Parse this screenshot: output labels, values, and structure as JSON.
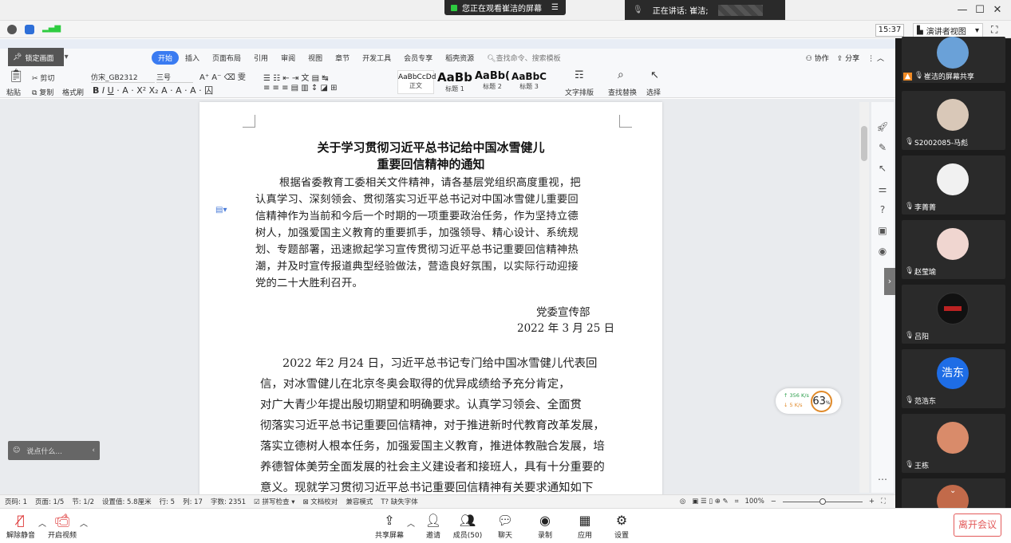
{
  "meeting": {
    "share_banner": "您正在观看崔洁的屏幕",
    "speaker_banner": "正在讲话: 崔洁;",
    "time": "15:37",
    "view_mode": "演讲者视图",
    "lock_label": "锁定画面",
    "chat_placeholder": "说点什么...",
    "leave": "离开会议"
  },
  "wps": {
    "menu": [
      "开始",
      "插入",
      "页面布局",
      "引用",
      "审阅",
      "视图",
      "章节",
      "开发工具",
      "会员专享",
      "稻壳资源"
    ],
    "search": "查找命令、搜索模板",
    "collab": "协作",
    "share": "分享",
    "font": "仿宋_GB2312",
    "font_size": "三号",
    "paste": "粘贴",
    "cut": "剪切",
    "copy": "复制",
    "format_painter": "格式刷",
    "styles": [
      {
        "sample": "AaBbCcDd",
        "name": "正文"
      },
      {
        "sample": "AaBb",
        "name": "标题 1"
      },
      {
        "sample": "AaBb(",
        "name": "标题 2"
      },
      {
        "sample": "AaBbC",
        "name": "标题 3"
      }
    ],
    "text_layout": "文字排版",
    "find_replace": "查找替换",
    "select": "选择"
  },
  "document": {
    "title1": "关于学习贯彻习近平总书记给中国冰雪健儿",
    "title2": "重要回信精神的通知",
    "para1": [
      "根据省委教育工委相关文件精神，请各基层党组织高度重视，把",
      "认真学习、深刻领会、贯彻落实习近平总书记对中国冰雪健儿重要回",
      "信精神作为当前和今后一个时期的一项重要政治任务，作为坚持立德",
      "树人，加强爱国主义教育的重要抓手，加强领导、精心设计、系统规",
      "划、专题部署，迅速掀起学习宣传贯彻习近平总书记重要回信精神热",
      "潮，并及时宣传报道典型经验做法，营造良好氛围，以实际行动迎接",
      "党的二十大胜利召开。"
    ],
    "signer": "党委宣传部",
    "date": "2022 年 3 月 25 日",
    "para2": [
      "2022 年2 月24 日，习近平总书记专门给中国冰雪健儿代表回",
      "信，对冰雪健儿在北京冬奥会取得的优异成绩给予充分肯定，",
      "对广大青少年提出殷切期望和明确要求。认真学习领会、全面贯",
      "彻落实习近平总书记重要回信精神，对于推进新时代教育改革发展，",
      "落实立德树人根本任务，加强爱国主义教育，推进体教融合发展，培",
      "养德智体美劳全面发展的社会主义建设者和接班人，具有十分重要的",
      "意义。现就学习贯彻习近平总书记重要回信精神有关要求通知如下"
    ]
  },
  "status": {
    "items": [
      "页码: 1",
      "页面: 1/5",
      "节: 1/2",
      "设置值: 5.8厘米",
      "行: 5",
      "列: 17",
      "字数: 2351",
      "拼写检查",
      "文档校对",
      "兼容模式",
      "缺失字体"
    ],
    "zoom": "100%"
  },
  "speed": {
    "up": "356 K/s",
    "down": "5 K/s",
    "percent": "63"
  },
  "participants": [
    {
      "name": "崔洁的屏幕共享",
      "color": "#6aa1d8"
    },
    {
      "name": "S2002085-马彪",
      "color": "#d9c8b8"
    },
    {
      "name": "李菁菁",
      "color": "#f1f1f1"
    },
    {
      "name": "赵莹瑜",
      "color": "#f0d6d0"
    },
    {
      "name": "吕阳",
      "color": "#111111"
    },
    {
      "name": "范浩东",
      "color": "#1e6de6",
      "initials": "浩东"
    },
    {
      "name": "王栋",
      "color": "#d98b6a"
    }
  ],
  "bottom": {
    "unmute": "解除静音",
    "start_video": "开启视频",
    "share_screen": "共享屏幕",
    "invite": "邀请",
    "members": "成员(50)",
    "chat": "聊天",
    "record": "录制",
    "apps": "应用",
    "settings": "设置"
  }
}
